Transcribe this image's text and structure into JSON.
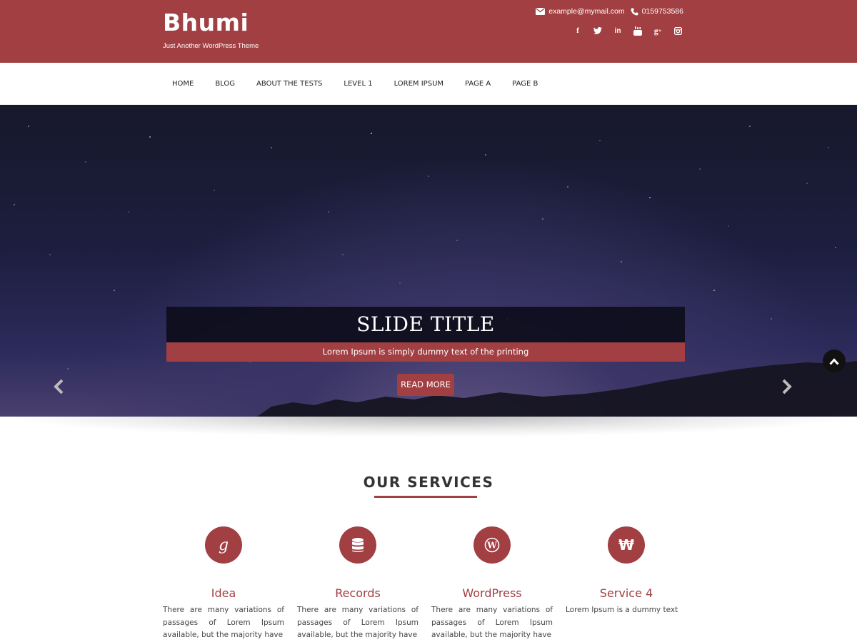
{
  "header": {
    "site_title": "Bhumi",
    "tagline": "Just Another WordPress Theme",
    "email": "example@mymail.com",
    "phone": "0159753586",
    "social_icons": [
      "facebook-icon",
      "twitter-icon",
      "linkedin-icon",
      "youtube-icon",
      "google-plus-icon",
      "instagram-icon"
    ],
    "colors": {
      "brand": "#a13f43"
    }
  },
  "nav": {
    "items": [
      "HOME",
      "BLOG",
      "ABOUT THE TESTS",
      "LEVEL 1",
      "LOREM IPSUM",
      "PAGE A",
      "PAGE B"
    ]
  },
  "slider": {
    "title": "SLIDE TITLE",
    "subtitle": "Lorem Ipsum is simply dummy text of the printing",
    "button_label": "READ MORE",
    "prev_icon": "chevron-left-icon",
    "next_icon": "chevron-right-icon"
  },
  "services": {
    "heading": "OUR SERVICES",
    "items": [
      {
        "icon": "google-icon",
        "title": "Idea",
        "text": "There are many variations of passages of Lorem Ipsum available, but the majority have"
      },
      {
        "icon": "database-icon",
        "title": "Records",
        "text": "There are many variations of passages of Lorem Ipsum available, but the majority have"
      },
      {
        "icon": "wordpress-icon",
        "title": "WordPress",
        "text": "There are many variations of passages of Lorem Ipsum available, but the majority have"
      },
      {
        "icon": "won-icon",
        "title": "Service 4",
        "text": "Lorem Ipsum is a dummy text"
      }
    ]
  },
  "scroll_top_icon": "chevron-up-icon"
}
